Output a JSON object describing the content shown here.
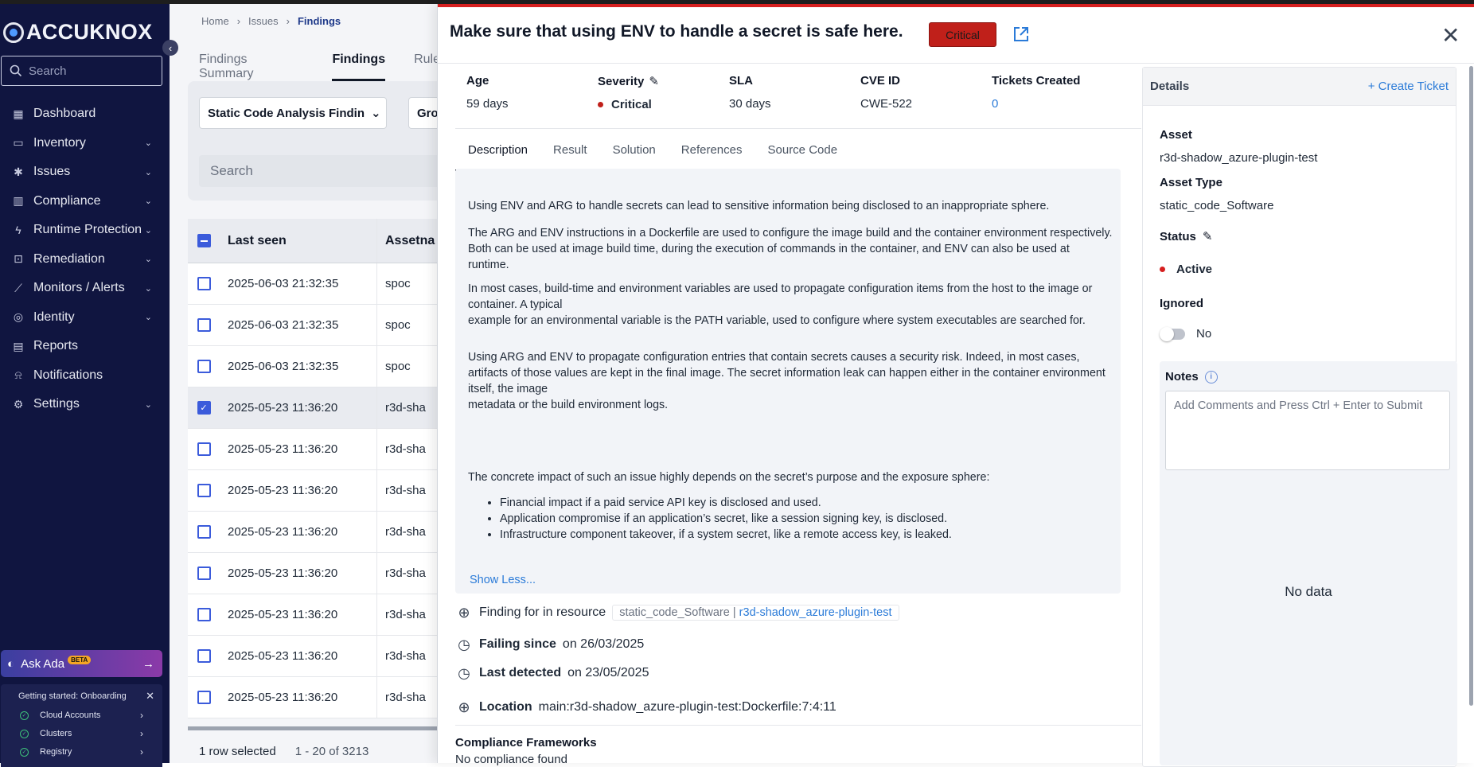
{
  "sidebar": {
    "logo": "ACCUKNOX",
    "search_placeholder": "Search",
    "items": [
      {
        "label": "Dashboard",
        "icon": "dashboard-icon",
        "chev": ""
      },
      {
        "label": "Inventory",
        "icon": "inventory-icon",
        "chev": "⌄"
      },
      {
        "label": "Issues",
        "icon": "bug-icon",
        "chev": "⌄"
      },
      {
        "label": "Compliance",
        "icon": "compliance-icon",
        "chev": "⌄"
      },
      {
        "label": "Runtime Protection",
        "icon": "runtime-icon",
        "chev": "⌄"
      },
      {
        "label": "Remediation",
        "icon": "lock-icon",
        "chev": "⌄"
      },
      {
        "label": "Monitors / Alerts",
        "icon": "chart-icon",
        "chev": "⌄"
      },
      {
        "label": "Identity",
        "icon": "fingerprint-icon",
        "chev": "⌄"
      },
      {
        "label": "Reports",
        "icon": "report-icon",
        "chev": ""
      },
      {
        "label": "Notifications",
        "icon": "bell-icon",
        "chev": ""
      },
      {
        "label": "Settings",
        "icon": "gear-icon",
        "chev": "⌄"
      }
    ],
    "ask_ada": "Ask Ada",
    "ask_ada_badge": "BETA",
    "onboarding": {
      "title": "Getting started: Onboarding",
      "items": [
        "Cloud Accounts",
        "Clusters",
        "Registry"
      ]
    }
  },
  "main": {
    "breadcrumb": [
      "Home",
      "Issues",
      "Findings"
    ],
    "tabs": [
      "Findings Summary",
      "Findings",
      "Rule"
    ],
    "filter1": "Static Code Analysis Findin",
    "filter2": "Gro",
    "search_placeholder": "Search",
    "columns": [
      "Last seen",
      "Assetna"
    ],
    "rows": [
      {
        "seen": "2025-06-03 21:32:35",
        "asset": "spoc",
        "selected": false
      },
      {
        "seen": "2025-06-03 21:32:35",
        "asset": "spoc",
        "selected": false
      },
      {
        "seen": "2025-06-03 21:32:35",
        "asset": "spoc",
        "selected": false
      },
      {
        "seen": "2025-05-23 11:36:20",
        "asset": "r3d-sha",
        "selected": true
      },
      {
        "seen": "2025-05-23 11:36:20",
        "asset": "r3d-sha",
        "selected": false
      },
      {
        "seen": "2025-05-23 11:36:20",
        "asset": "r3d-sha",
        "selected": false
      },
      {
        "seen": "2025-05-23 11:36:20",
        "asset": "r3d-sha",
        "selected": false
      },
      {
        "seen": "2025-05-23 11:36:20",
        "asset": "r3d-sha",
        "selected": false
      },
      {
        "seen": "2025-05-23 11:36:20",
        "asset": "r3d-sha",
        "selected": false
      },
      {
        "seen": "2025-05-23 11:36:20",
        "asset": "r3d-sha",
        "selected": false
      },
      {
        "seen": "2025-05-23 11:36:20",
        "asset": "r3d-sha",
        "selected": false
      }
    ],
    "footer_selected": "1 row selected",
    "footer_range": "1 - 20 of 3213"
  },
  "drawer": {
    "title": "Make sure that using ENV to handle a secret is safe here.",
    "severity_badge": "Critical",
    "meta": {
      "age_label": "Age",
      "age": "59 days",
      "severity_label": "Severity",
      "severity": "Critical",
      "sla_label": "SLA",
      "sla": "30 days",
      "cve_label": "CVE ID",
      "cve": "CWE-522",
      "tickets_label": "Tickets Created",
      "tickets": "0"
    },
    "tabs": [
      "Description",
      "Result",
      "Solution",
      "References",
      "Source Code"
    ],
    "description": {
      "p1": "Using ENV and ARG to handle secrets can lead to sensitive information being disclosed to an inappropriate sphere.",
      "p2a": "The ARG and ENV instructions in a Dockerfile are used to configure the image build and the container environment respectively. Both can be used at image build time, during the execution of commands in the container, and ENV can also be used at",
      "p2b": "runtime.",
      "p3a": "In most cases, build-time and environment variables are used to propagate configuration items from the host to the image or container. A typical",
      "p3b": "example for an environmental variable is the PATH variable, used to configure where system executables are searched for.",
      "p4a": "Using ARG and ENV to propagate configuration entries that contain secrets causes a security risk. Indeed, in most cases,",
      "p4b": "artifacts of those values are kept in the final image. The secret information leak can happen either in the container environment itself, the image",
      "p4c": "metadata or the build environment logs.",
      "p5": "The concrete impact of such an issue highly depends on the secret’s purpose and the exposure sphere:",
      "bullets": [
        "Financial impact if a paid service API key is disclosed and used.",
        "Application compromise if an application’s secret, like a session signing key, is disclosed.",
        "Infrastructure component takeover, if a system secret, like a remote access key, is leaked."
      ],
      "show_less": "Show Less..."
    },
    "finding": {
      "resource_label": "Finding for in resource",
      "resource_type": "static_code_Software",
      "resource_sep": "|",
      "resource_name": "r3d-shadow_azure-plugin-test",
      "failing_label": "Failing since",
      "failing_value": "on 26/03/2025",
      "detected_label": "Last detected",
      "detected_value": "on 23/05/2025",
      "location_label": "Location",
      "location_value": "main:r3d-shadow_azure-plugin-test:Dockerfile:7:4:11"
    },
    "compliance_label": "Compliance Frameworks",
    "compliance_value": "No compliance found",
    "details": {
      "header": "Details",
      "create_ticket": "+ Create Ticket",
      "asset_label": "Asset",
      "asset": "r3d-shadow_azure-plugin-test",
      "asset_type_label": "Asset Type",
      "asset_type": "static_code_Software",
      "status_label": "Status",
      "status": "Active",
      "ignored_label": "Ignored",
      "ignored": "No",
      "notes_label": "Notes",
      "notes_placeholder": "Add Comments and Press Ctrl + Enter to Submit",
      "no_data": "No data"
    }
  },
  "colors": {
    "critical": "#c0201a",
    "link": "#2b7bd8",
    "sidebar_bg": "#101540",
    "accent_bar": "#d61f1f"
  }
}
